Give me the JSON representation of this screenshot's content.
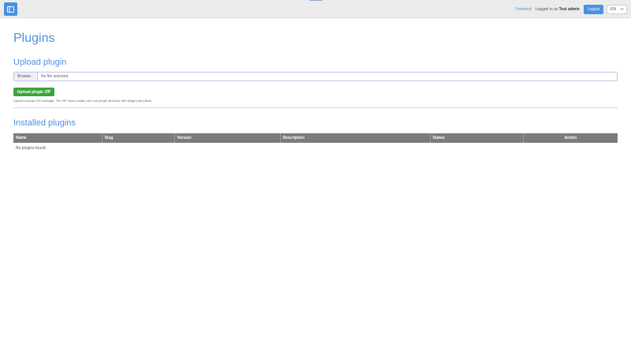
{
  "header": {
    "frontend_label": "Frontend",
    "logged_prefix": "Logged in as",
    "user_name": "Test admin",
    "logout_label": "Logout",
    "language": "EN"
  },
  "page": {
    "title": "Plugins"
  },
  "upload": {
    "title": "Upload plugin",
    "browse_label": "Browse...",
    "file_status": "No file selected.",
    "submit_label": "Upload plugin ZIP",
    "help_text": "Upload a plugin ZIP package. The ZIP must contain one root plugin directory with plugin.php inside."
  },
  "installed": {
    "title": "Installed plugins",
    "columns": [
      "Name",
      "Slug",
      "Version",
      "Description",
      "Status",
      "Action"
    ],
    "empty_message": "No plugins found."
  },
  "colors": {
    "accent": "#4a90e2",
    "success": "#3aa53a",
    "table_header": "#7b7b7b"
  }
}
